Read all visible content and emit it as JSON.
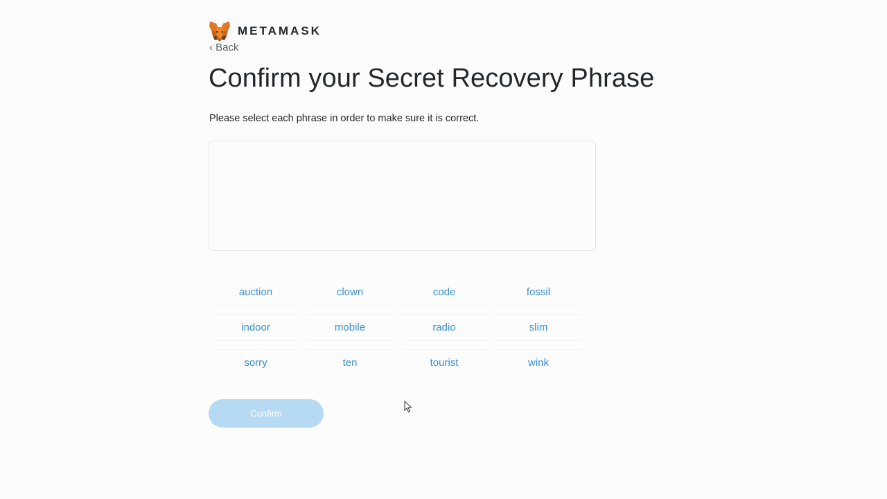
{
  "brand": {
    "name": "METAMASK",
    "logo_icon": "metamask-fox-icon"
  },
  "nav": {
    "back_label": "‹ Back"
  },
  "page": {
    "title": "Confirm your Secret Recovery Phrase",
    "instructions": "Please select each phrase in order to make sure it is correct."
  },
  "words": [
    "auction",
    "clown",
    "code",
    "fossil",
    "indoor",
    "mobile",
    "radio",
    "slim",
    "sorry",
    "ten",
    "tourist",
    "wink"
  ],
  "actions": {
    "confirm_label": "Confirm",
    "confirm_enabled": false
  },
  "colors": {
    "word_text": "#3a8fd0",
    "confirm_disabled_bg": "#b6daf4",
    "fox_orange": "#e2761b"
  }
}
